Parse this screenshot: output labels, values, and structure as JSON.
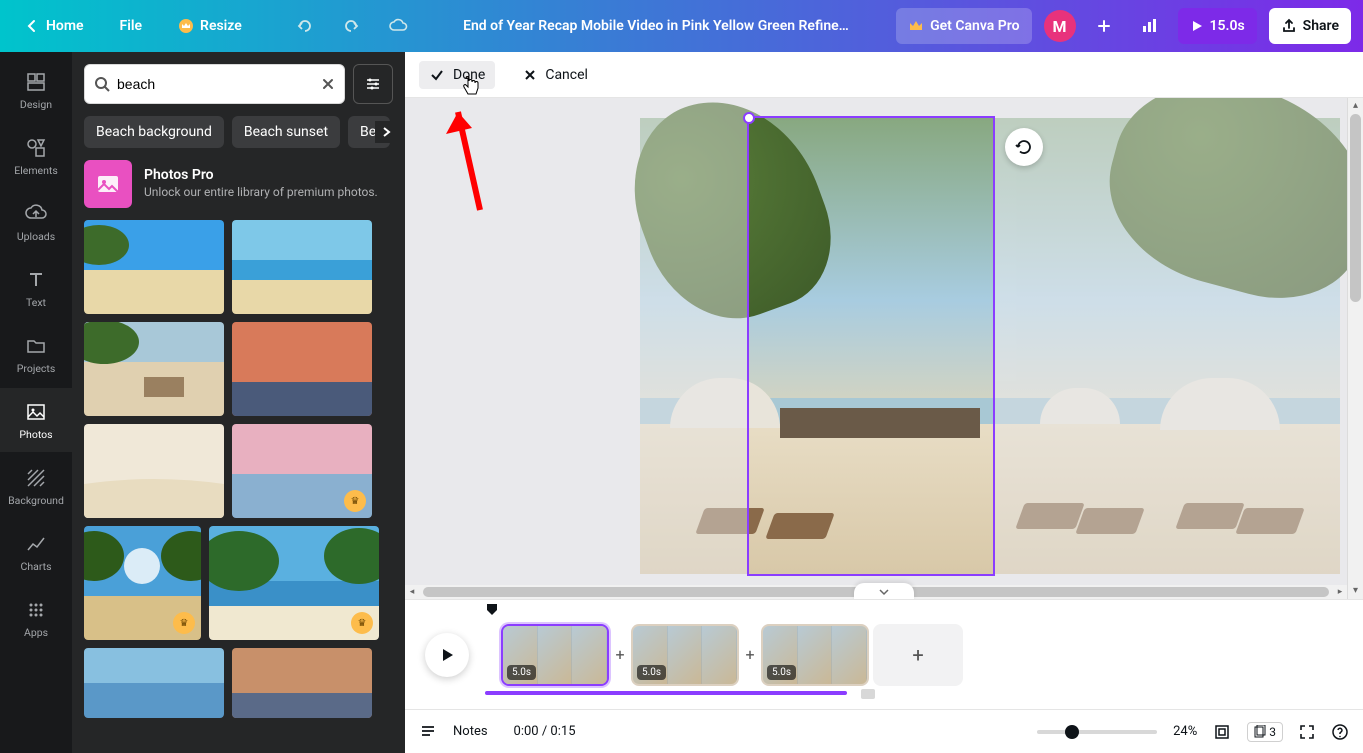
{
  "header": {
    "home": "Home",
    "file": "File",
    "resize": "Resize",
    "title": "End of Year Recap Mobile Video in Pink Yellow Green Refine…",
    "getPro": "Get Canva Pro",
    "avatar": "M",
    "duration": "15.0s",
    "share": "Share"
  },
  "rail": {
    "design": "Design",
    "elements": "Elements",
    "uploads": "Uploads",
    "text": "Text",
    "projects": "Projects",
    "photos": "Photos",
    "background": "Background",
    "charts": "Charts",
    "apps": "Apps"
  },
  "panel": {
    "searchValue": "beach",
    "chips": [
      "Beach background",
      "Beach sunset",
      "Beach"
    ],
    "promoTitle": "Photos Pro",
    "promoSub": "Unlock our entire library of premium photos."
  },
  "crop": {
    "done": "Done",
    "cancel": "Cancel"
  },
  "timeline": {
    "clipDuration": "5.0s"
  },
  "bottom": {
    "notes": "Notes",
    "time": "0:00 / 0:15",
    "zoom": "24%",
    "pages": "3"
  }
}
